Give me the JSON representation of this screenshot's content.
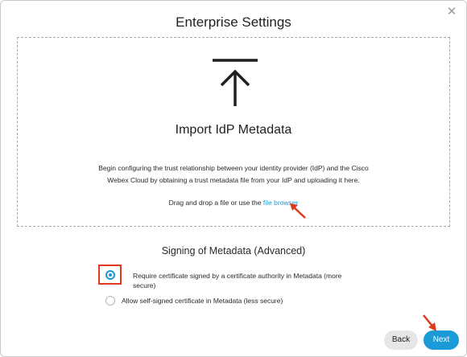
{
  "dialog": {
    "title": "Enterprise Settings",
    "close_icon": "close-icon"
  },
  "import": {
    "icon": "upload-arrow-icon",
    "heading": "Import IdP Metadata",
    "description_line1": "Begin configuring the trust relationship between your identity provider (IdP) and the Cisco",
    "description_line2": "Webex Cloud by obtaining a trust metadata file from your IdP and uploading it here.",
    "drag_text": "Drag and drop a file or use the ",
    "file_browser_link": "file browser"
  },
  "signing": {
    "title": "Signing of Metadata (Advanced)",
    "options": [
      {
        "label_line1": "Require certificate signed by a certificate authority in Metadata (more",
        "label_line2": "secure)",
        "selected": true
      },
      {
        "label": "Allow self-signed certificate in Metadata (less secure)",
        "selected": false
      }
    ]
  },
  "footer": {
    "back_label": "Back",
    "next_label": "Next"
  },
  "colors": {
    "accent": "#1a9bd7",
    "annotation": "#e03a1e"
  }
}
